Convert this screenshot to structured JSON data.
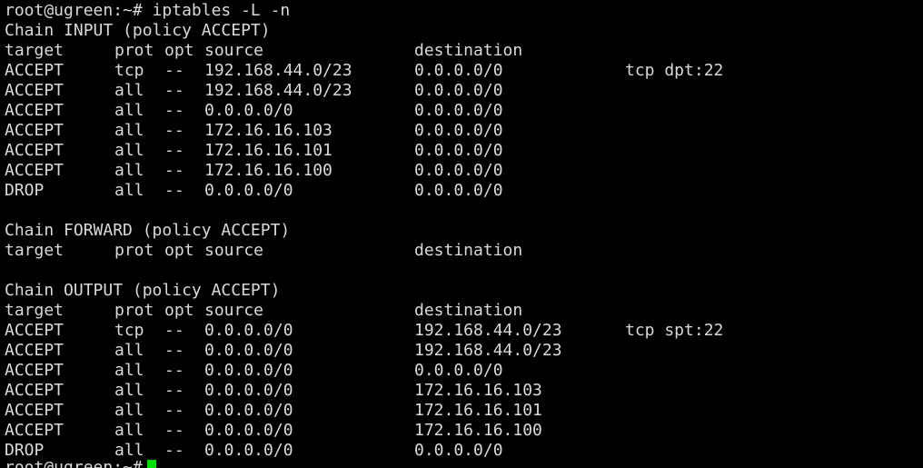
{
  "terminal": {
    "command_line": "root@ugreen:~# iptables -L -n",
    "prompt_partial": "root@ugreen:~#",
    "cursor_color": "#00e000",
    "text_color": "#d9d9d9",
    "background_color": "#000000",
    "chains": [
      {
        "header": "Chain INPUT (policy ACCEPT)",
        "columns": {
          "target": "target",
          "prot": "prot",
          "opt": "opt",
          "source": "source",
          "destination": "destination"
        },
        "rules": [
          {
            "target": "ACCEPT",
            "prot": "tcp",
            "opt": "--",
            "source": "192.168.44.0/23",
            "destination": "0.0.0.0/0",
            "extra": "tcp dpt:22"
          },
          {
            "target": "ACCEPT",
            "prot": "all",
            "opt": "--",
            "source": "192.168.44.0/23",
            "destination": "0.0.0.0/0",
            "extra": ""
          },
          {
            "target": "ACCEPT",
            "prot": "all",
            "opt": "--",
            "source": "0.0.0.0/0",
            "destination": "0.0.0.0/0",
            "extra": ""
          },
          {
            "target": "ACCEPT",
            "prot": "all",
            "opt": "--",
            "source": "172.16.16.103",
            "destination": "0.0.0.0/0",
            "extra": ""
          },
          {
            "target": "ACCEPT",
            "prot": "all",
            "opt": "--",
            "source": "172.16.16.101",
            "destination": "0.0.0.0/0",
            "extra": ""
          },
          {
            "target": "ACCEPT",
            "prot": "all",
            "opt": "--",
            "source": "172.16.16.100",
            "destination": "0.0.0.0/0",
            "extra": ""
          },
          {
            "target": "DROP",
            "prot": "all",
            "opt": "--",
            "source": "0.0.0.0/0",
            "destination": "0.0.0.0/0",
            "extra": ""
          }
        ]
      },
      {
        "header": "Chain FORWARD (policy ACCEPT)",
        "columns": {
          "target": "target",
          "prot": "prot",
          "opt": "opt",
          "source": "source",
          "destination": "destination"
        },
        "rules": []
      },
      {
        "header": "Chain OUTPUT (policy ACCEPT)",
        "columns": {
          "target": "target",
          "prot": "prot",
          "opt": "opt",
          "source": "source",
          "destination": "destination"
        },
        "rules": [
          {
            "target": "ACCEPT",
            "prot": "tcp",
            "opt": "--",
            "source": "0.0.0.0/0",
            "destination": "192.168.44.0/23",
            "extra": "tcp spt:22"
          },
          {
            "target": "ACCEPT",
            "prot": "all",
            "opt": "--",
            "source": "0.0.0.0/0",
            "destination": "192.168.44.0/23",
            "extra": ""
          },
          {
            "target": "ACCEPT",
            "prot": "all",
            "opt": "--",
            "source": "0.0.0.0/0",
            "destination": "0.0.0.0/0",
            "extra": ""
          },
          {
            "target": "ACCEPT",
            "prot": "all",
            "opt": "--",
            "source": "0.0.0.0/0",
            "destination": "172.16.16.103",
            "extra": ""
          },
          {
            "target": "ACCEPT",
            "prot": "all",
            "opt": "--",
            "source": "0.0.0.0/0",
            "destination": "172.16.16.101",
            "extra": ""
          },
          {
            "target": "ACCEPT",
            "prot": "all",
            "opt": "--",
            "source": "0.0.0.0/0",
            "destination": "172.16.16.100",
            "extra": ""
          },
          {
            "target": "DROP",
            "prot": "all",
            "opt": "--",
            "source": "0.0.0.0/0",
            "destination": "0.0.0.0/0",
            "extra": ""
          }
        ]
      }
    ]
  }
}
